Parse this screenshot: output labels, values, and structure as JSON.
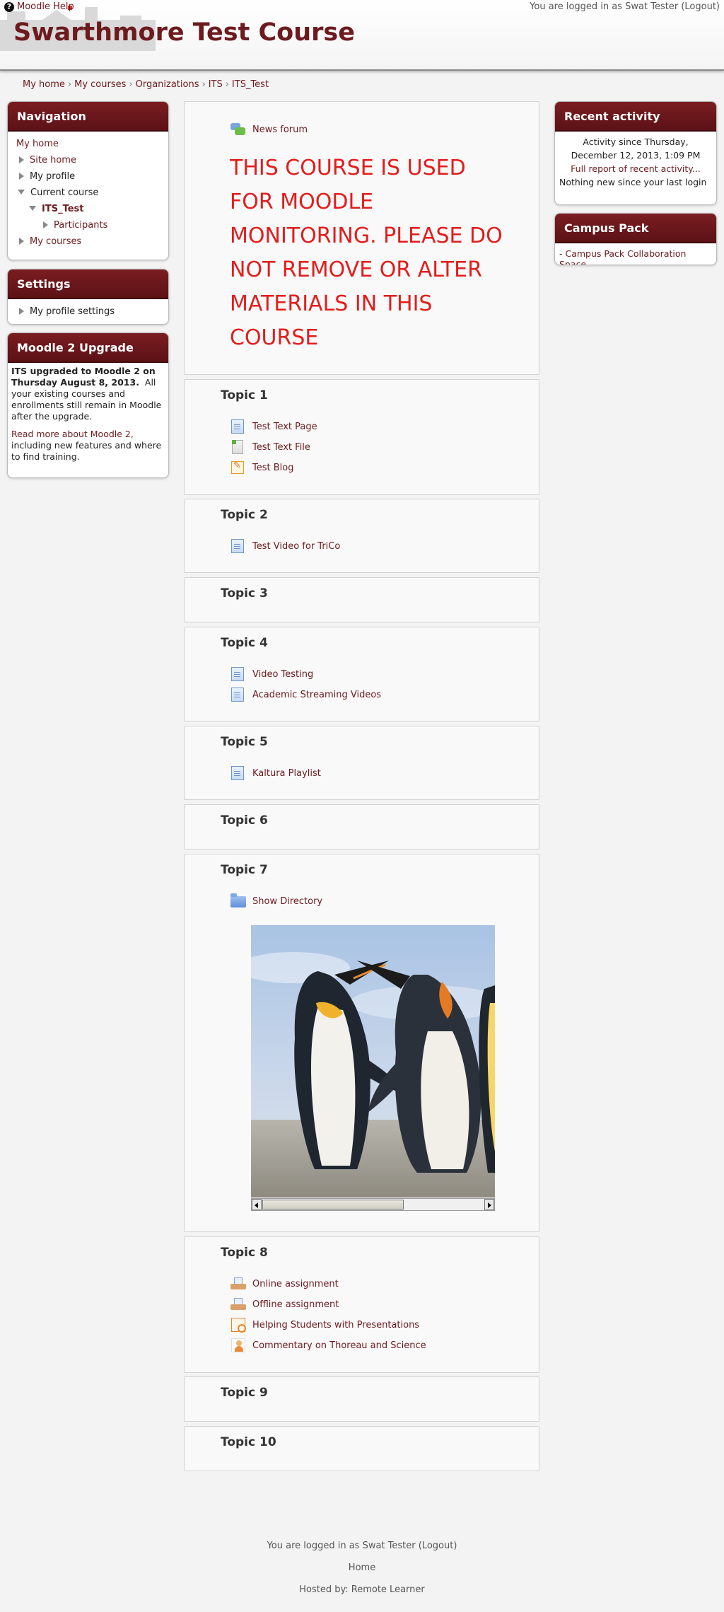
{
  "header": {
    "help_link": "Moodle Help",
    "login_text": "You are logged in as Swat Tester",
    "logout_label": "(Logout)",
    "site_title": "Swarthmore Test Course"
  },
  "breadcrumb": [
    "My home",
    "My courses",
    "Organizations",
    "ITS",
    "ITS_Test"
  ],
  "navigation": {
    "title": "Navigation",
    "my_home": "My home",
    "site_home": "Site home",
    "my_profile": "My profile",
    "current_course": "Current course",
    "course": "ITS_Test",
    "participants": "Participants",
    "my_courses": "My courses"
  },
  "settings": {
    "title": "Settings",
    "my_profile_settings": "My profile settings"
  },
  "upgrade": {
    "title": "Moodle 2 Upgrade",
    "bold_text": "ITS upgraded to Moodle 2 on Thursday August 8, 2013.",
    "text": "All your existing courses and enrollments still remain in Moodle after the upgrade.",
    "link": "Read more about Moodle 2,",
    "link_suffix": "including new features and where to find training."
  },
  "recent_activity": {
    "title": "Recent activity",
    "since": "Activity since Thursday, December 12, 2013, 1:09 PM",
    "full_report": "Full report of recent activity...",
    "nothing_new": "Nothing new since your last login"
  },
  "campus_pack": {
    "title": "Campus Pack",
    "link": "- Campus Pack Collaboration Space"
  },
  "course": {
    "news_forum": "News forum",
    "notice": "THIS COURSE IS USED FOR MOODLE MONITORING.  PLEASE DO NOT REMOVE OR ALTER MATERIALS IN THIS COURSE",
    "topics": [
      {
        "title": "Topic 1",
        "activities": [
          "Test Text Page",
          "Test Text File",
          "Test Blog"
        ]
      },
      {
        "title": "Topic 2",
        "activities": [
          "Test Video for TriCo"
        ]
      },
      {
        "title": "Topic 3",
        "activities": []
      },
      {
        "title": "Topic 4",
        "activities": [
          "Video Testing",
          "Academic Streaming Videos"
        ]
      },
      {
        "title": "Topic 5",
        "activities": [
          "Kaltura Playlist"
        ]
      },
      {
        "title": "Topic 6",
        "activities": []
      },
      {
        "title": "Topic 7",
        "activities": [
          "Show Directory"
        ]
      },
      {
        "title": "Topic 8",
        "activities": [
          "Online assignment",
          "Offline assignment",
          "Helping Students with Presentations",
          "Commentary on Thoreau and Science"
        ]
      },
      {
        "title": "Topic 9",
        "activities": []
      },
      {
        "title": "Topic 10",
        "activities": []
      }
    ]
  },
  "icons": {
    "help": "help-icon",
    "page": "page-icon",
    "file": "file-icon",
    "blog": "blog-icon",
    "folder": "folder-icon",
    "forum": "forum-icon",
    "assignment": "assignment-icon"
  },
  "footer": {
    "login_text": "You are logged in as Swat Tester",
    "logout_label": "(Logout)",
    "home": "Home",
    "hosted_by": "Hosted by: Remote Learner"
  },
  "colors": {
    "brand": "#6d1a1e",
    "notice": "#e21d1d"
  }
}
